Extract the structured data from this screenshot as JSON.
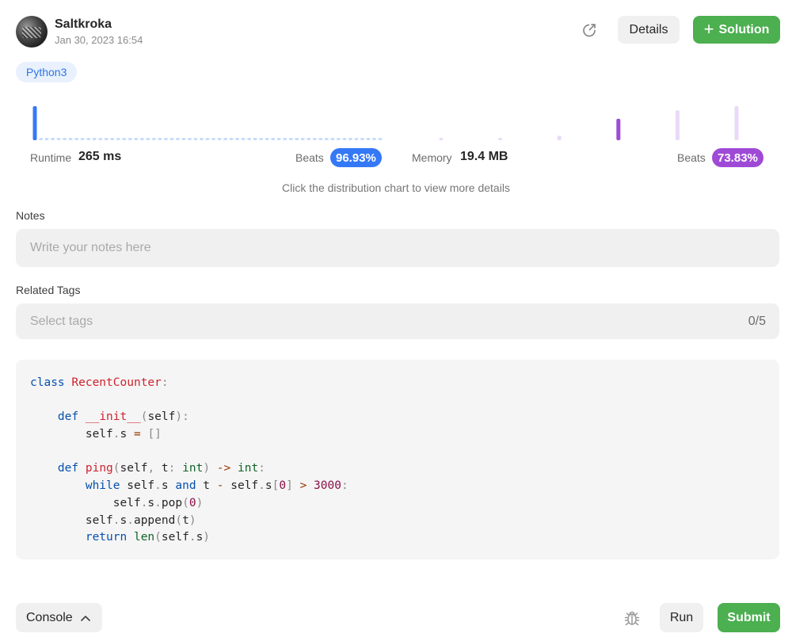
{
  "header": {
    "username": "Saltkroka",
    "datetime": "Jan 30, 2023 16:54",
    "details_label": "Details",
    "solution_label": "Solution",
    "language": "Python3"
  },
  "stats": {
    "runtime_label": "Runtime",
    "runtime_value": "265 ms",
    "runtime_beats_label": "Beats",
    "runtime_beats": "96.93%",
    "memory_label": "Memory",
    "memory_value": "19.4 MB",
    "memory_beats_label": "Beats",
    "memory_beats": "73.83%",
    "hint": "Click the distribution chart to view more details"
  },
  "chart_data": {
    "type": "bar",
    "series": [
      {
        "colors": {
          "selected": "#3478f6",
          "other": "#c8dcfb"
        },
        "values": [
          1.0,
          0.04,
          0.04,
          0.04,
          0.04,
          0.04,
          0.04,
          0.04,
          0.04,
          0.04,
          0.04,
          0.04,
          0.04,
          0.04,
          0.04,
          0.04,
          0.04,
          0.04,
          0.04,
          0.04,
          0.04,
          0.04,
          0.04,
          0.04,
          0.04,
          0.04,
          0.04,
          0.04,
          0.04,
          0.04,
          0.04,
          0.04,
          0.04,
          0.04,
          0.04,
          0.04,
          0.04,
          0.04,
          0.04,
          0.04,
          0.04,
          0.04,
          0.04,
          0.04,
          0.04,
          0.04,
          0.04,
          0.04,
          0.04,
          0.04,
          0.04,
          0.04,
          0.04,
          0.04,
          0.04,
          0.04,
          0.04,
          0.04,
          0.04
        ],
        "selected_index": 0
      },
      {
        "colors": {
          "selected": "#9f4ad6",
          "other": "#ead9f7"
        },
        "values": [
          0.05,
          0.05,
          0.13,
          0.63,
          0.88,
          1.0
        ],
        "selected_index": 3
      }
    ]
  },
  "notes": {
    "label": "Notes",
    "placeholder": "Write your notes here",
    "value": ""
  },
  "tags": {
    "label": "Related Tags",
    "placeholder": "Select tags",
    "count": "0/5"
  },
  "footer": {
    "console_label": "Console",
    "run_label": "Run",
    "submit_label": "Submit"
  },
  "icons": {
    "share": "share-icon",
    "plus": "plus-icon",
    "chevron": "chevron-up-icon",
    "debug": "bug-icon"
  },
  "colors": {
    "accent_green": "#4caf50",
    "runtime_blue": "#3478f6",
    "memory_purple": "#9f4ad6"
  }
}
